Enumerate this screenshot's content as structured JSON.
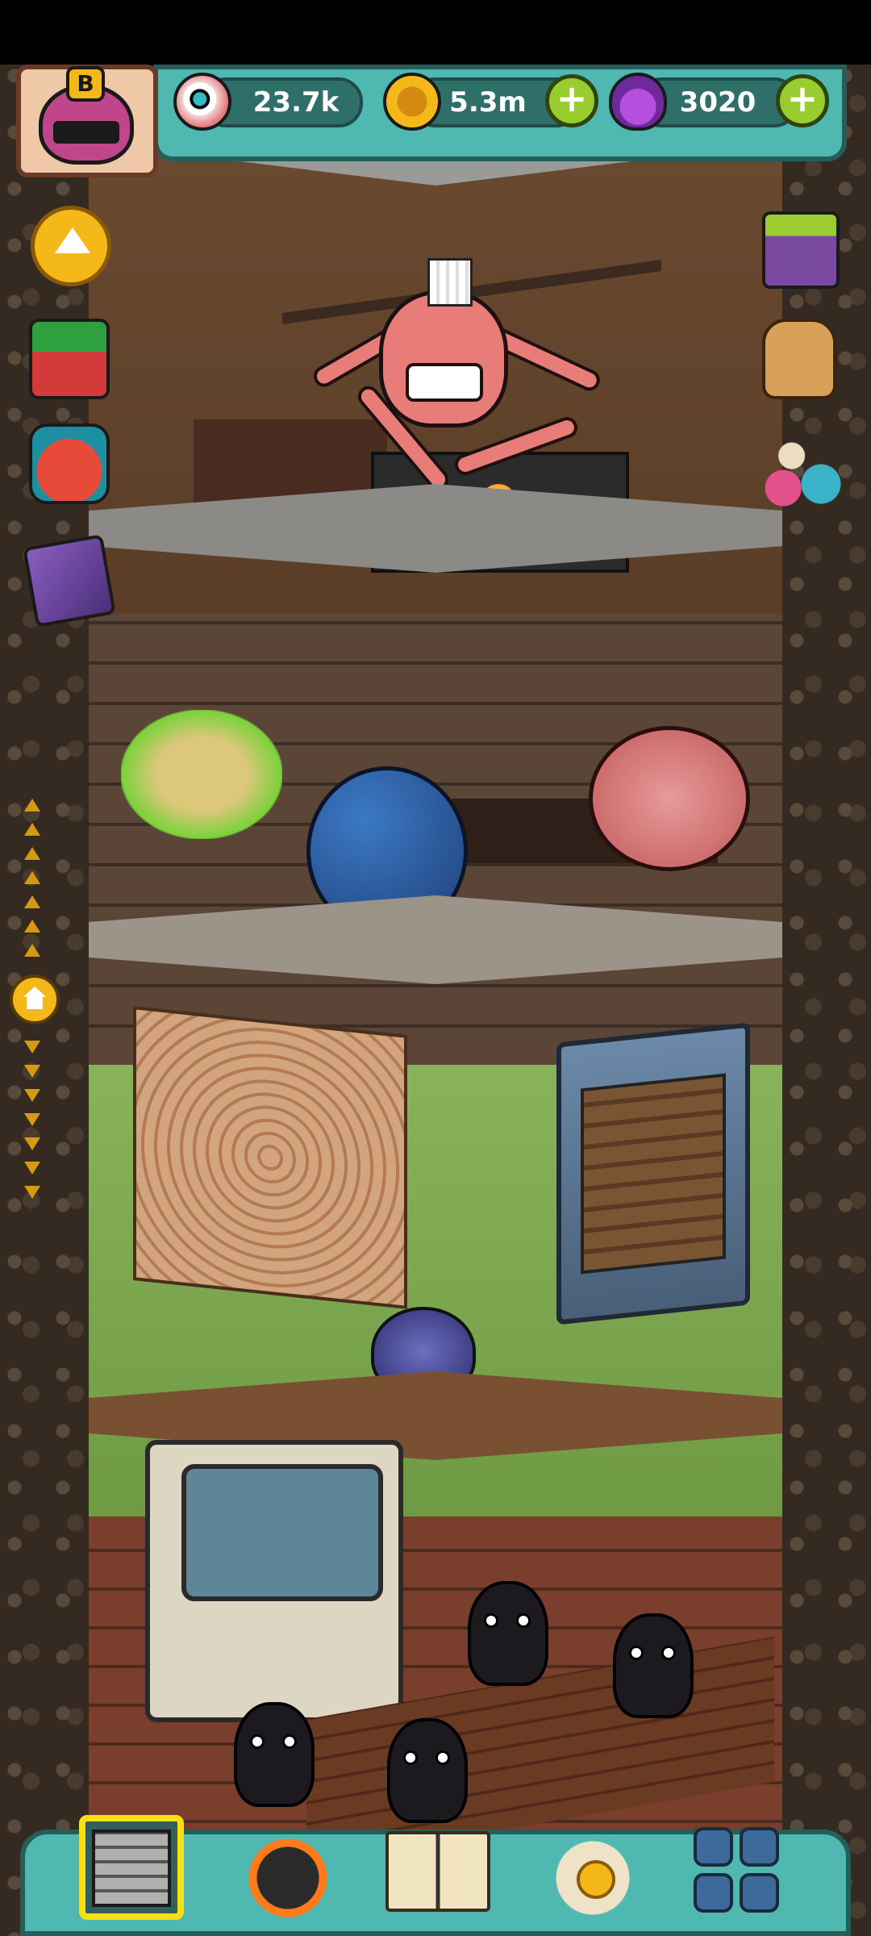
{
  "hud": {
    "avatar_badge": "B",
    "eyes": "23.7k",
    "coins": "5.3m",
    "potions": "3020",
    "plus_symbol": "+"
  },
  "icons": {
    "avatar": "monster-avatar-icon",
    "eyeball": "eyeball-currency-icon",
    "coin": "coin-currency-icon",
    "potion": "potion-currency-icon",
    "scroll_up": "up-arrow-icon",
    "gift": "gift-box-icon",
    "gift_bundle": "gift-bundle-icon",
    "cards": "cards-icon",
    "home": "home-icon",
    "tv_ad": "video-reward-icon",
    "backpack": "backpack-icon",
    "eye_creatures": "eye-creatures-icon",
    "nav_building": "building-icon",
    "nav_furnace": "furnace-icon",
    "nav_book": "book-icon",
    "nav_money_sack": "money-sack-icon",
    "nav_menu_grid": "menu-grid-icon"
  },
  "colors": {
    "hud_teal": "#4fb9b1",
    "hud_border": "#255d59",
    "gold": "#f5b819",
    "plus_green": "#98cc2f",
    "nav_selected": "#f5e018"
  },
  "nav": {
    "selected_index": 0
  }
}
